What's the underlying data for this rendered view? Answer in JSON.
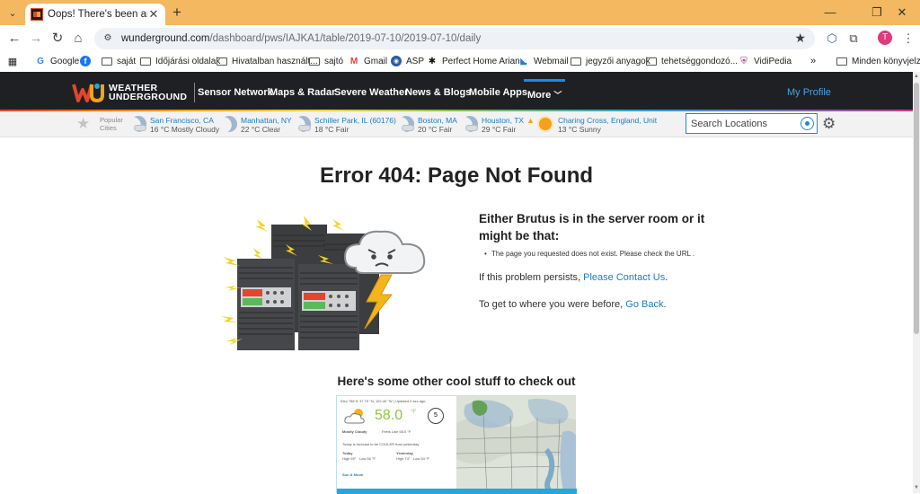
{
  "browser": {
    "tab_title": "Oops! There's been an error | W",
    "url_host": "wunderground.com",
    "url_path": "/dashboard/pws/IAJKA1/table/2019-07-10/2019-07-10/daily",
    "profile_initial": "T",
    "bookmarks": [
      {
        "label": "Google",
        "icon": "google-icon"
      },
      {
        "label": "",
        "icon": "facebook-icon"
      },
      {
        "label": "saját",
        "icon": "folder-icon"
      },
      {
        "label": "Időjárási oldalak",
        "icon": "folder-icon"
      },
      {
        "label": "Hivatalban használt...",
        "icon": "folder-icon"
      },
      {
        "label": "sajtó",
        "icon": "folder-icon"
      },
      {
        "label": "Gmail",
        "icon": "gmail-icon"
      },
      {
        "label": "ASP",
        "icon": "asp-icon"
      },
      {
        "label": "Perfect Home Arian...",
        "icon": "perfect-home-icon"
      },
      {
        "label": "Webmail",
        "icon": "webmail-icon"
      },
      {
        "label": "jegyzői anyagok",
        "icon": "folder-icon"
      },
      {
        "label": "tehetséggondozó...",
        "icon": "folder-icon"
      },
      {
        "label": "VidiPedia",
        "icon": "vidipedia-icon"
      }
    ],
    "bookmarks_overflow": "»",
    "other_bookmarks": "Minden könyvjelző"
  },
  "site": {
    "logo_line1": "WEATHER",
    "logo_line2": "UNDERGROUND",
    "nav": [
      "Sensor Network",
      "Maps & Radar",
      "Severe Weather",
      "News & Blogs",
      "Mobile Apps",
      "More"
    ],
    "my_profile": "My Profile",
    "popular_label_1": "Popular",
    "popular_label_2": "Cities",
    "cities": [
      {
        "name": "San Francisco, CA",
        "cond": "16 °C Mostly Cloudy",
        "icon": "partly-cloudy-night-icon"
      },
      {
        "name": "Manhattan, NY",
        "cond": "22 °C Clear",
        "icon": "clear-night-icon"
      },
      {
        "name": "Schiller Park, IL (60176)",
        "cond": "18 °C Fair",
        "icon": "partly-cloudy-night-icon"
      },
      {
        "name": "Boston, MA",
        "cond": "20 °C Fair",
        "icon": "partly-cloudy-night-icon"
      },
      {
        "name": "Houston, TX",
        "cond": "29 °C Fair",
        "icon": "partly-cloudy-night-icon",
        "alert": true
      },
      {
        "name": "Charing Cross, England, Unit",
        "cond": "13 °C Sunny",
        "icon": "sunny-icon"
      }
    ],
    "search_placeholder": "Search Locations"
  },
  "error": {
    "title": "Error 404: Page Not Found",
    "heading": "Either Brutus is in the server room or it might be that:",
    "bullet": "The page you requested does not exist. Please check the URL .",
    "persist_prefix": "If this problem persists, ",
    "persist_link": "Please Contact Us",
    "persist_suffix": ".",
    "back_prefix": "To get to where you were before, ",
    "back_link": "Go Back",
    "back_suffix": "."
  },
  "cool": {
    "title": "Here's some other cool stuff to check out",
    "card": {
      "temp": "58.0",
      "unit": "°F",
      "wind": "5",
      "cond": "Mostly Cloudy",
      "feels": "Feels Like 58.0 °F",
      "forecast": "Today is forecast to be COOLER than yesterday.",
      "today": "Today",
      "yesterday": "Yesterday",
      "today_hilo": "High 69° · Low 56 °F",
      "yesterday_hilo": "High 74° · Low 54 °F",
      "sun_moon": "Sun & Moon",
      "elev": "Elev 788 ft, 37.79 °N, 122.40 °W | Updated 2 sec ago"
    }
  },
  "colors": {
    "chrome_tabstrip": "#f4b860",
    "wu_nav": "#1f2023",
    "link": "#1e7bc2",
    "accent": "#1e88e5"
  }
}
